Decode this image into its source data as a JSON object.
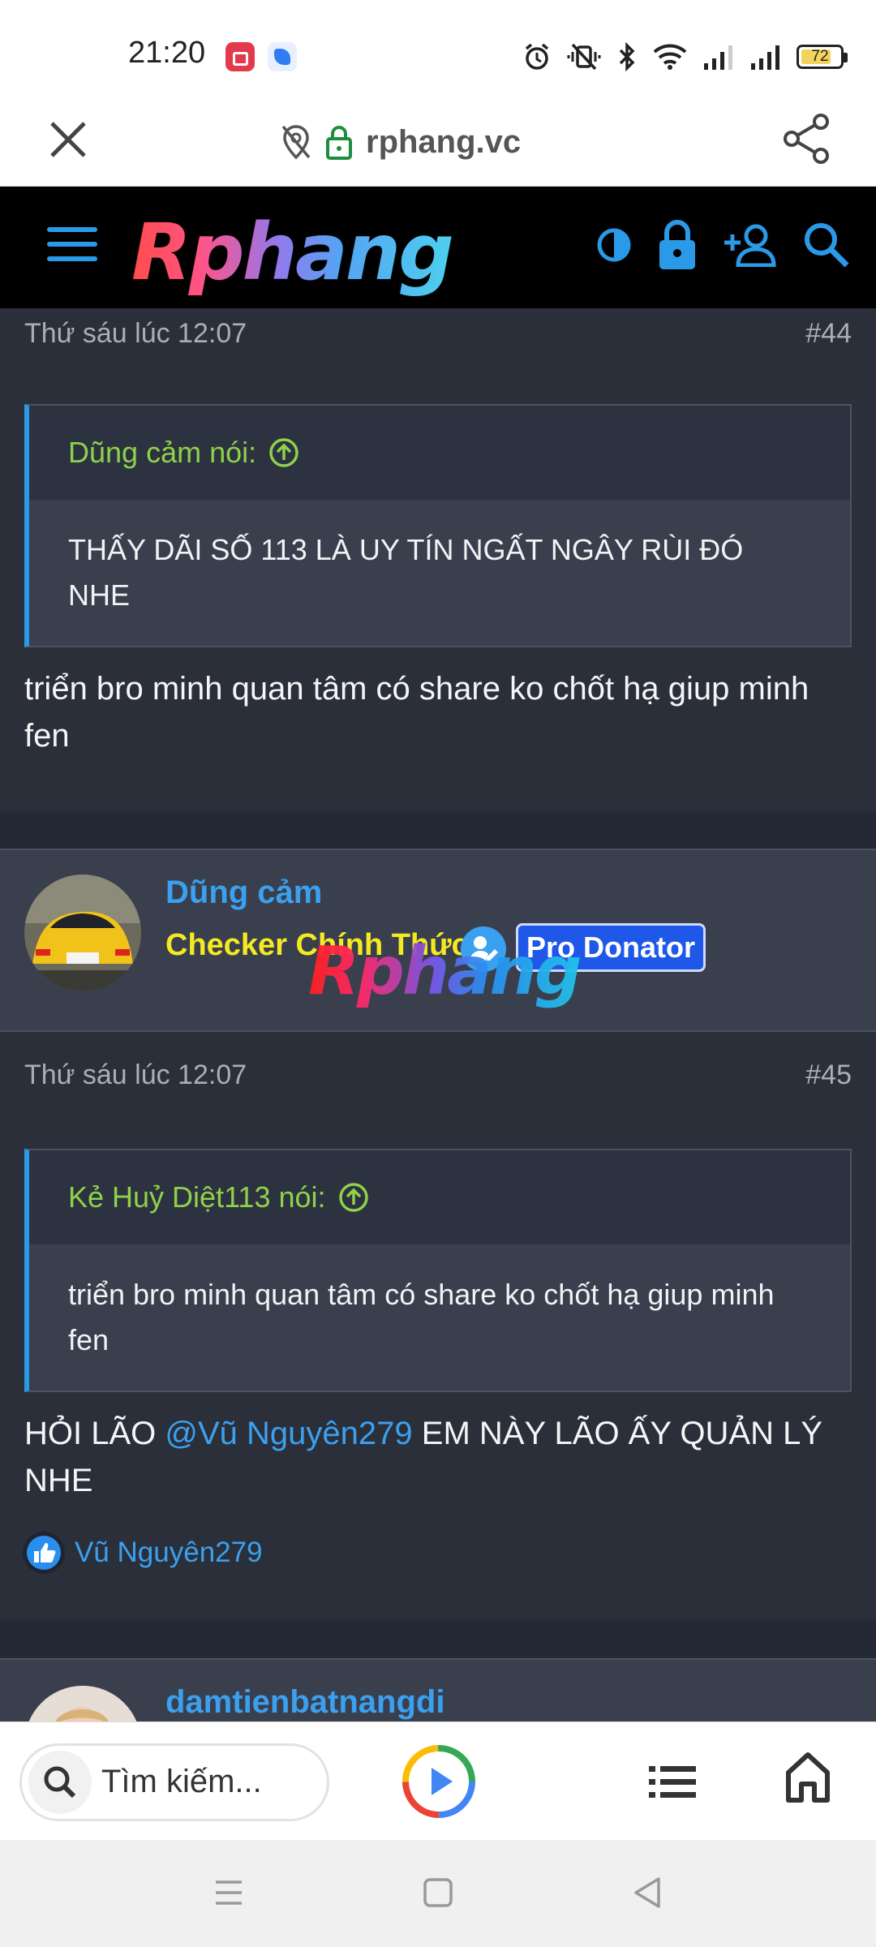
{
  "status_bar": {
    "time": "21:20",
    "battery": "72",
    "icons": [
      "video-app-icon",
      "blue-app-icon",
      "alarm-icon",
      "vibrate-off-icon",
      "bluetooth-icon",
      "wifi-icon",
      "signal-icon",
      "signal-icon",
      "battery-icon"
    ]
  },
  "browser": {
    "url": "rphang.vc",
    "close_icon": "close-icon",
    "share_icon": "share-icon"
  },
  "header": {
    "logo_text": "Rphang",
    "icons": [
      "menu-icon",
      "theme-toggle-icon",
      "lock-icon",
      "register-icon",
      "search-icon"
    ],
    "accent": "#2a9ae8"
  },
  "posts": [
    {
      "date": "Thứ sáu lúc 12:07",
      "number": "#44",
      "quote_author": "Dũng cảm nói:",
      "quote_text": "THẤY DÃI SỐ 113 LÀ UY TÍN NGẤT NGÂY RÙI ĐÓ NHE",
      "body": "triển bro minh quan tâm có share ko chốt hạ giup minh fen"
    },
    {
      "username": "Dũng cảm",
      "user_title": "Checker Chính Thức",
      "badge": "Pro Donator",
      "watermark": "Rphang",
      "date": "Thứ sáu lúc 12:07",
      "number": "#45",
      "quote_author": "Kẻ Huỷ Diệt113 nói:",
      "quote_text": "triển bro minh quan tâm có share ko chốt hạ giup minh fen",
      "body_before": "HỎI LÃO ",
      "mention": "@Vũ Nguyên279",
      "body_after": " EM NÀY LÃO ẤY QUẢN LÝ NHE",
      "reaction_user": "Vũ Nguyên279"
    },
    {
      "username": "damtienbatnangdi"
    }
  ],
  "bottom_toolbar": {
    "search_placeholder": "Tìm kiếm...",
    "icons": [
      "search-icon",
      "play-icon",
      "list-icon",
      "home-icon"
    ]
  },
  "system_nav": {
    "icons": [
      "recents-icon",
      "home-square-icon",
      "back-icon"
    ]
  }
}
